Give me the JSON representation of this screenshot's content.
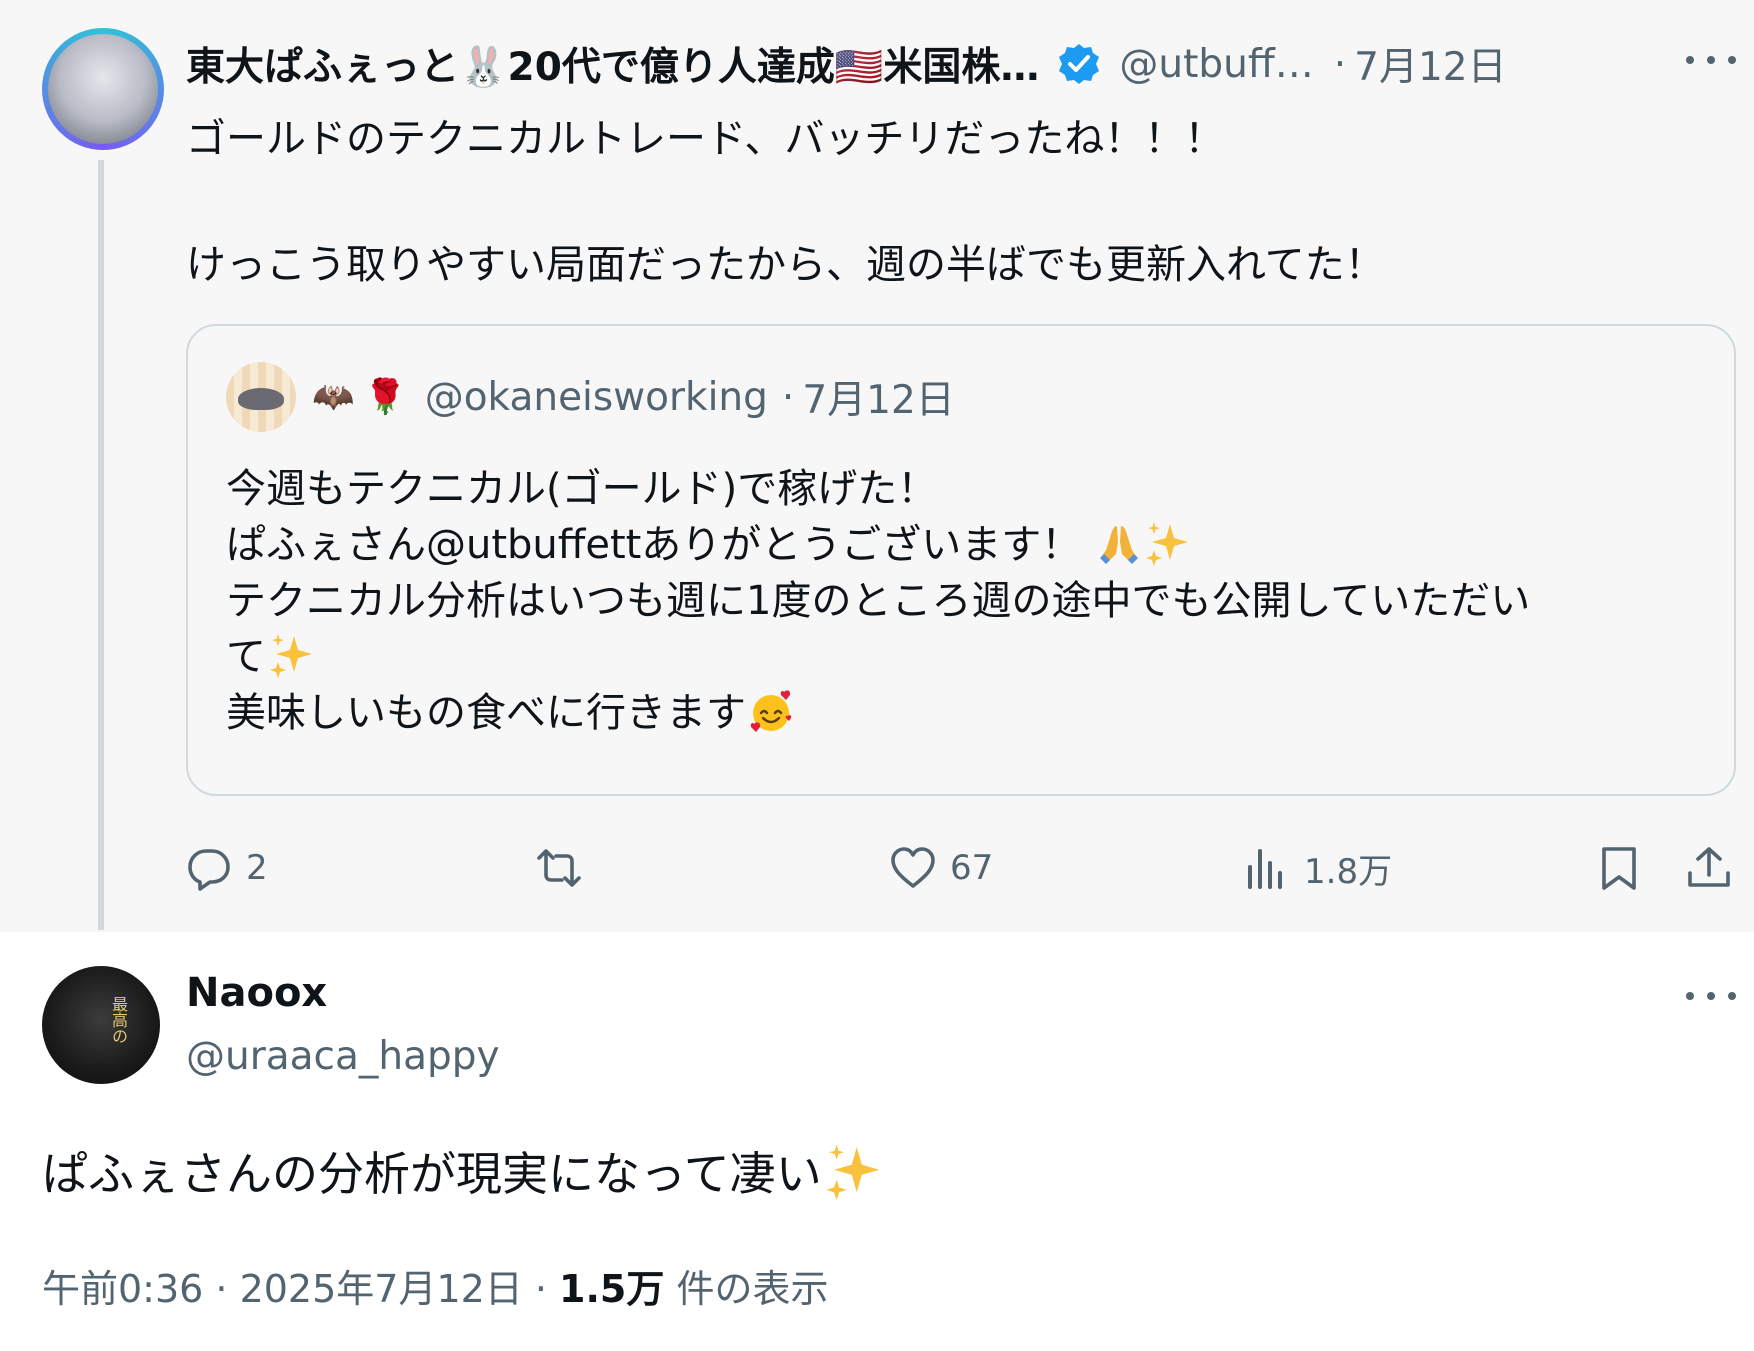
{
  "parent_tweet": {
    "author_name": "東大ぱふぇっと🐰20代で億り人達成🇺🇸米国株…",
    "handle": "@utbuff…",
    "date": "7月12日",
    "text_line1": "ゴールドのテクニカルトレード、バッチリだったね！！！",
    "text_line2": "けっこう取りやすい局面だったから、週の半ばでも更新入れてた！",
    "quote": {
      "avatar_emoji": "🦇",
      "name_emoji_bat": "🦇",
      "name_emoji_rose": "🌹",
      "handle": "@okaneisworking",
      "date": "7月12日",
      "line1": "今週もテクニカル(ゴールド)で稼げた！",
      "line2": "ぱふぇさん@utbuffettありがとうございます！",
      "line3": "テクニカル分析はいつも週に1度のところ週の途中でも公開していただい",
      "line4": "て",
      "line5": "美味しいもの食べに行きます"
    },
    "actions": {
      "replies": "2",
      "reposts": "",
      "likes": "67",
      "views": "1.8万"
    }
  },
  "reply_tweet": {
    "author_name": "Naoox",
    "handle": "@uraaca_happy",
    "text": "ぱふぇさんの分析が現実になって凄い",
    "timestamp": "午前0:36 · 2025年7月12日 · ",
    "view_count": "1.5万",
    "view_label": " 件の表示"
  },
  "icons": {
    "verified": "verified-badge-icon",
    "reply": "reply-icon",
    "repost": "repost-icon",
    "like": "heart-icon",
    "views": "views-icon",
    "bookmark": "bookmark-icon",
    "share": "share-icon",
    "more": "more-icon",
    "sparkles": "sparkles-icon",
    "pray": "pray-icon",
    "smiling_hearts": "smiling-hearts-icon"
  },
  "colors": {
    "accent": "#1d9bf0",
    "secondary_text": "#536471",
    "parent_bg": "#f7f7f7"
  }
}
